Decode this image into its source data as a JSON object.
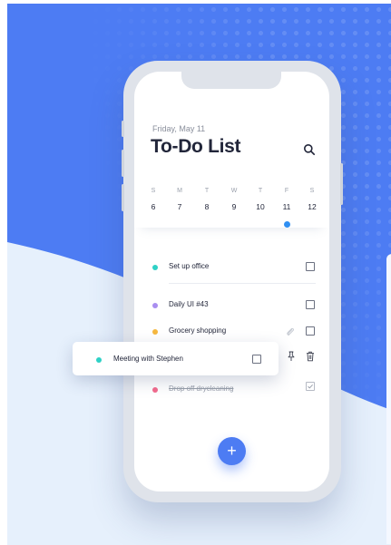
{
  "colors": {
    "background_blue": "#4d7cf3",
    "background_light": "#e6f0fc",
    "accent_blue": "#2f8ff2",
    "text_dark": "#22263a"
  },
  "header": {
    "date": "Friday, May 11",
    "title": "To-Do List",
    "search_icon": "search-icon"
  },
  "week": {
    "days": [
      {
        "letter": "S",
        "number": "6"
      },
      {
        "letter": "M",
        "number": "7"
      },
      {
        "letter": "T",
        "number": "8"
      },
      {
        "letter": "W",
        "number": "9"
      },
      {
        "letter": "T",
        "number": "10"
      },
      {
        "letter": "F",
        "number": "11"
      },
      {
        "letter": "S",
        "number": "12"
      }
    ],
    "selected_day": "11"
  },
  "tasks": [
    {
      "label": "Set up office",
      "dot_color": "#2ed1c6",
      "done": false
    },
    {
      "label": "Daily UI #43",
      "dot_color": "#a98ef0",
      "done": false,
      "icon": "none"
    },
    {
      "label": "Grocery shopping",
      "dot_color": "#f6b83f",
      "done": false,
      "icon": "paperclip-icon"
    },
    {
      "label": "Drop off drycleaning",
      "dot_color": "#f36b8d",
      "done": true
    }
  ],
  "dragged_task": {
    "label": "Meeting with Stephen",
    "dot_color": "#2ed1c6",
    "swipe_actions": [
      "pin-icon",
      "trash-icon"
    ]
  },
  "fab": {
    "label": "+"
  }
}
